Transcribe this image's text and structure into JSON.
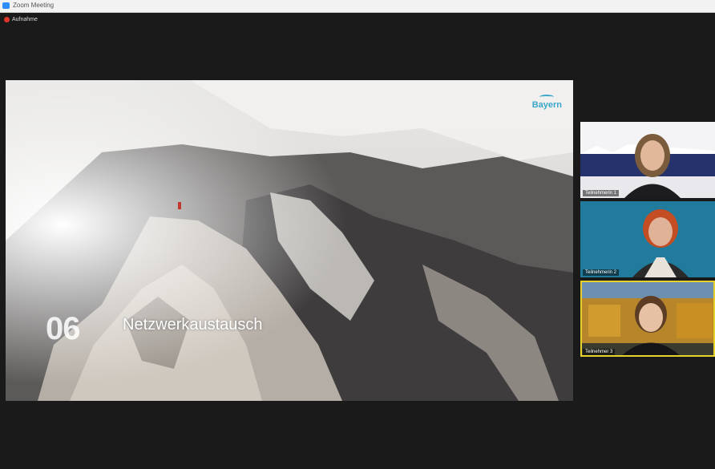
{
  "window": {
    "title": "Zoom Meeting"
  },
  "recording": {
    "label": "Aufnahme"
  },
  "slide": {
    "number": "06",
    "title": "Netzwerkaustausch",
    "logo": "Bayern"
  },
  "participants": [
    {
      "name": "Teilnehmerin 1"
    },
    {
      "name": "Teilnehmerin 2"
    },
    {
      "name": "Teilnehmer 3"
    }
  ],
  "colors": {
    "recording": "#e0342b",
    "active_speaker": "#e6d22b",
    "accent": "#2d8cff"
  }
}
